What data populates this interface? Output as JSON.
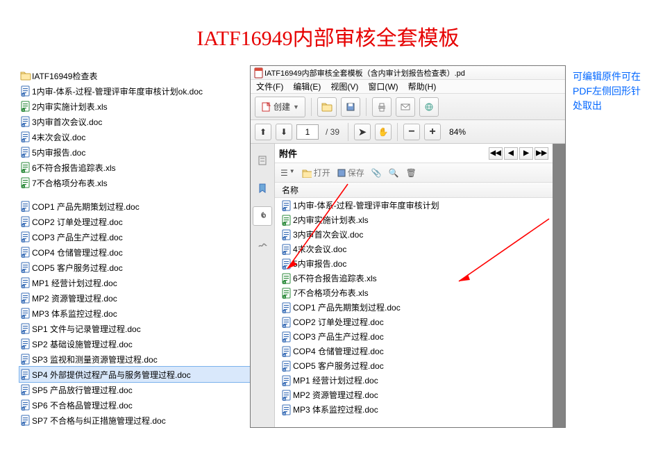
{
  "title": "IATF16949内部审核全套模板",
  "note_lines": [
    "可编辑原件可在",
    "PDF左侧回形针",
    "处取出"
  ],
  "left_files_top": [
    {
      "icon": "folder",
      "name": "IATF16949检查表"
    },
    {
      "icon": "doc",
      "name": "1内审-体系-过程-管理评审年度审核计划ok.doc"
    },
    {
      "icon": "xls",
      "name": "2内审实施计划表.xls"
    },
    {
      "icon": "doc",
      "name": "3内审首次会议.doc"
    },
    {
      "icon": "doc",
      "name": "4末次会议.doc"
    },
    {
      "icon": "doc",
      "name": "5内审报告.doc"
    },
    {
      "icon": "xls",
      "name": "6不符合报告追踪表.xls"
    },
    {
      "icon": "xls",
      "name": "7不合格项分布表.xls"
    }
  ],
  "left_files_bottom": [
    {
      "icon": "doc",
      "name": "COP1 产品先期策划过程.doc"
    },
    {
      "icon": "doc",
      "name": "COP2 订单处理过程.doc"
    },
    {
      "icon": "doc",
      "name": "COP3 产品生产过程.doc"
    },
    {
      "icon": "doc",
      "name": "COP4 仓储管理过程.doc"
    },
    {
      "icon": "doc",
      "name": "COP5 客户服务过程.doc"
    },
    {
      "icon": "doc",
      "name": "MP1  经营计划过程.doc"
    },
    {
      "icon": "doc",
      "name": "MP2  资源管理过程.doc"
    },
    {
      "icon": "doc",
      "name": "MP3 体系监控过程.doc"
    },
    {
      "icon": "doc",
      "name": "SP1  文件与记录管理过程.doc"
    },
    {
      "icon": "doc",
      "name": "SP2  基础设施管理过程.doc"
    },
    {
      "icon": "doc",
      "name": "SP3  监视和测量资源管理过程.doc"
    },
    {
      "icon": "doc",
      "name": "SP4  外部提供过程产品与服务管理过程.doc",
      "selected": true
    },
    {
      "icon": "doc",
      "name": "SP5  产品放行管理过程.doc"
    },
    {
      "icon": "doc",
      "name": "SP6  不合格品管理过程.doc"
    },
    {
      "icon": "doc",
      "name": "SP7   不合格与纠正措施管理过程.doc"
    }
  ],
  "pdf": {
    "title": "IATF16949内部审核全套模板（含内审计划报告检查表）.pd",
    "menu": {
      "file": "文件(F)",
      "edit": "编辑(E)",
      "view": "视图(V)",
      "window": "窗口(W)",
      "help": "帮助(H)"
    },
    "toolbar": {
      "create": "创建",
      "page_current": "1",
      "page_total": "/ 39",
      "zoom": "84%"
    },
    "attachments": {
      "header": "附件",
      "open": "打开",
      "save": "保存",
      "col_name": "名称",
      "items": [
        {
          "icon": "doc",
          "name": "1内审-体系-过程-管理评审年度审核计划"
        },
        {
          "icon": "xls",
          "name": "2内审实施计划表.xls"
        },
        {
          "icon": "doc",
          "name": "3内审首次会议.doc"
        },
        {
          "icon": "doc",
          "name": "4末次会议.doc"
        },
        {
          "icon": "doc",
          "name": "5内审报告.doc"
        },
        {
          "icon": "xls",
          "name": "6不符合报告追踪表.xls"
        },
        {
          "icon": "xls",
          "name": "7不合格项分布表.xls"
        },
        {
          "icon": "doc",
          "name": "COP1 产品先期策划过程.doc"
        },
        {
          "icon": "doc",
          "name": "COP2 订单处理过程.doc"
        },
        {
          "icon": "doc",
          "name": "COP3 产品生产过程.doc"
        },
        {
          "icon": "doc",
          "name": "COP4 仓储管理过程.doc"
        },
        {
          "icon": "doc",
          "name": "COP5 客户服务过程.doc"
        },
        {
          "icon": "doc",
          "name": "MP1  经营计划过程.doc"
        },
        {
          "icon": "doc",
          "name": "MP2  资源管理过程.doc"
        },
        {
          "icon": "doc",
          "name": "MP3 体系监控过程.doc"
        }
      ]
    }
  }
}
